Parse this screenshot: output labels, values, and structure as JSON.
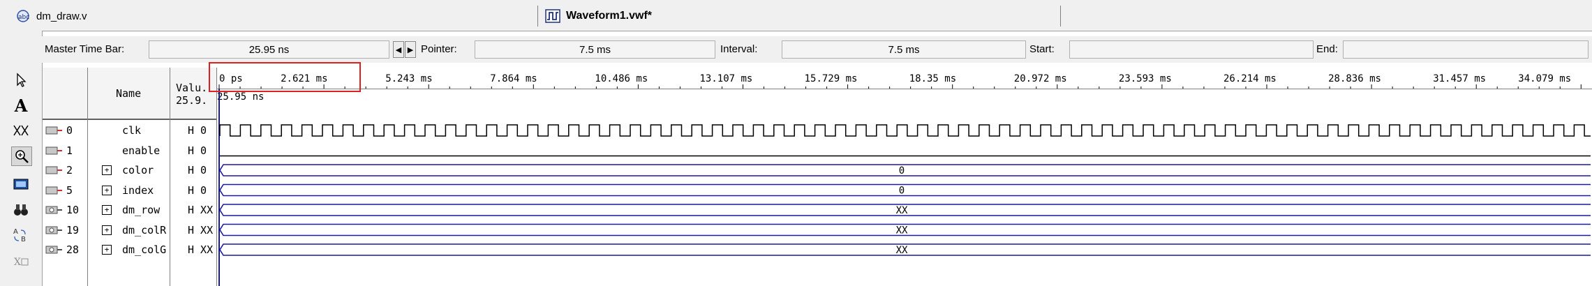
{
  "tabs": {
    "design_file": "dm_draw.v",
    "waveform_file": "Waveform1.vwf*"
  },
  "timebar": {
    "master_label": "Master Time Bar:",
    "master_value": "25.95 ns",
    "pointer_label": "Pointer:",
    "pointer_value": "7.5 ms",
    "interval_label": "Interval:",
    "interval_value": "7.5 ms",
    "start_label": "Start:",
    "start_value": "",
    "end_label": "End:",
    "end_value": ""
  },
  "table": {
    "name_header": "Name",
    "value_header": "Valu.",
    "value_sub": "25.9.",
    "signals": [
      {
        "index": "0",
        "name": "clk",
        "value": "H 0",
        "expandable": false,
        "type": "clock"
      },
      {
        "index": "1",
        "name": "enable",
        "value": "H 0",
        "expandable": false,
        "type": "low"
      },
      {
        "index": "2",
        "name": "color",
        "value": "H 0",
        "expandable": true,
        "type": "bus",
        "bus_value": "0"
      },
      {
        "index": "5",
        "name": "index",
        "value": "H 0",
        "expandable": true,
        "type": "bus",
        "bus_value": "0"
      },
      {
        "index": "10",
        "name": "dm_row",
        "value": "H XX",
        "expandable": true,
        "type": "bus",
        "bus_value": "XX"
      },
      {
        "index": "19",
        "name": "dm_colR",
        "value": "H XX",
        "expandable": true,
        "type": "bus",
        "bus_value": "XX"
      },
      {
        "index": "28",
        "name": "dm_colG",
        "value": "H XX",
        "expandable": true,
        "type": "bus",
        "bus_value": "XX"
      }
    ]
  },
  "ruler": {
    "ticks": [
      "0 ps",
      "2.621 ms",
      "5.243 ms",
      "7.864 ms",
      "10.486 ms",
      "13.107 ms",
      "15.729 ms",
      "18.35 ms",
      "20.972 ms",
      "23.593 ms",
      "26.214 ms",
      "28.836 ms",
      "31.457 ms",
      "34.079 ms"
    ],
    "cursor_label": "25.95 ns"
  },
  "colors": {
    "wave": "#1a1a9a",
    "highlight": "#e02020",
    "panel": "#f0f0f0"
  }
}
